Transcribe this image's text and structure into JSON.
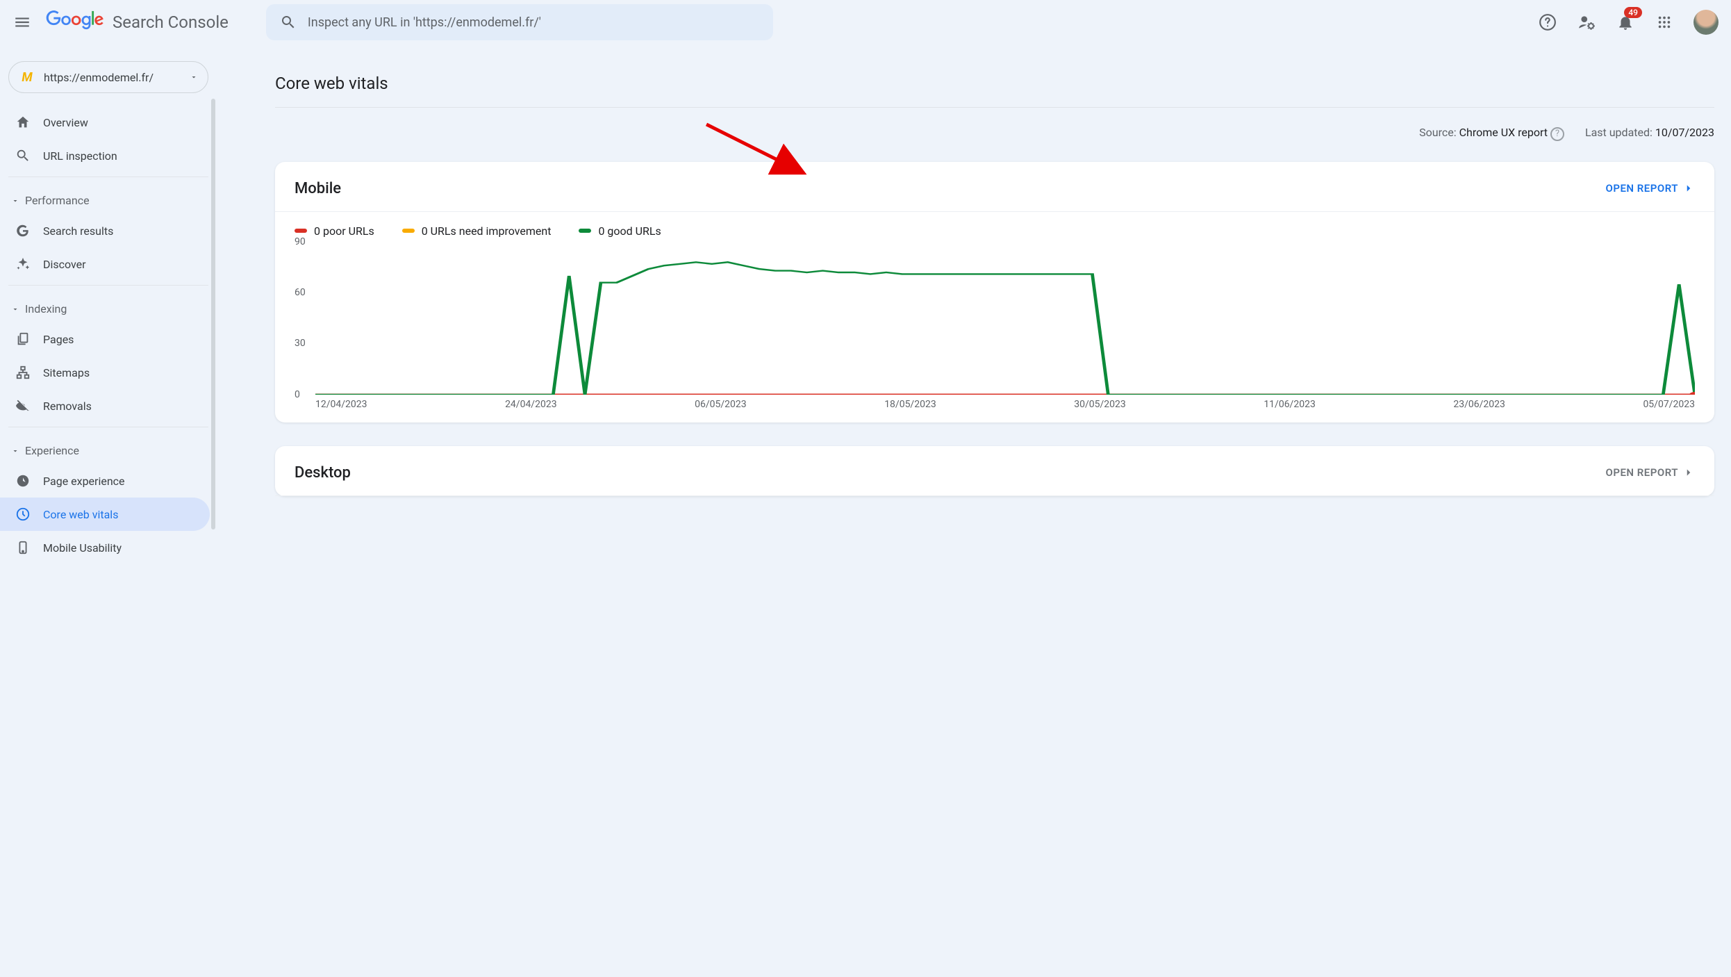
{
  "header": {
    "product": "Search Console",
    "search_placeholder": "Inspect any URL in 'https://enmodemel.fr/'",
    "notif_count": "49"
  },
  "sidebar": {
    "property_url": "https://enmodemel.fr/",
    "overview": "Overview",
    "url_inspection": "URL inspection",
    "sections": {
      "performance": {
        "label": "Performance",
        "items": [
          "Search results",
          "Discover"
        ]
      },
      "indexing": {
        "label": "Indexing",
        "items": [
          "Pages",
          "Sitemaps",
          "Removals"
        ]
      },
      "experience": {
        "label": "Experience",
        "items": [
          "Page experience",
          "Core web vitals",
          "Mobile Usability"
        ]
      }
    },
    "active": "Core web vitals"
  },
  "page": {
    "title": "Core web vitals",
    "source_label": "Source: ",
    "source_value": "Chrome UX report",
    "updated_label": "Last updated: ",
    "updated_value": "10/07/2023"
  },
  "cards": {
    "mobile": {
      "title": "Mobile",
      "open": "OPEN REPORT"
    },
    "desktop": {
      "title": "Desktop",
      "open": "OPEN REPORT"
    }
  },
  "legend": {
    "poor": "0 poor URLs",
    "need": "0 URLs need improvement",
    "good": "0 good URLs"
  },
  "chart_data": {
    "type": "line",
    "x_ticks": [
      "12/04/2023",
      "24/04/2023",
      "06/05/2023",
      "18/05/2023",
      "30/05/2023",
      "11/06/2023",
      "23/06/2023",
      "05/07/2023"
    ],
    "ylim": [
      0,
      90
    ],
    "y_ticks": [
      0,
      30,
      60,
      90
    ],
    "series": [
      {
        "name": "poor",
        "color": "#d93025",
        "values": [
          0,
          0,
          0,
          0,
          0,
          0,
          0,
          0,
          0,
          0,
          0,
          0,
          0,
          0,
          0,
          0,
          0,
          0,
          0,
          0,
          0,
          0,
          0,
          0,
          0,
          0,
          0,
          0,
          0,
          0,
          0,
          0,
          0,
          0,
          0,
          0,
          0,
          0,
          0,
          0,
          0,
          0,
          0,
          0,
          0,
          0,
          0,
          0,
          0,
          0,
          0,
          0,
          0,
          0,
          0,
          0,
          0,
          0,
          0,
          0,
          0,
          0,
          0,
          0,
          0,
          0,
          0,
          0,
          0,
          0,
          0,
          0,
          0,
          0,
          0,
          0,
          0,
          0,
          0,
          0,
          0,
          0,
          0,
          0,
          0,
          0,
          0,
          0
        ]
      },
      {
        "name": "good",
        "color": "#0d8a3a",
        "values": [
          0,
          0,
          0,
          0,
          0,
          0,
          0,
          0,
          0,
          0,
          0,
          0,
          0,
          0,
          0,
          0,
          70,
          0,
          66,
          66,
          70,
          74,
          76,
          77,
          78,
          77,
          78,
          76,
          74,
          73,
          73,
          72,
          73,
          72,
          72,
          71,
          72,
          71,
          71,
          71,
          71,
          71,
          71,
          71,
          71,
          71,
          71,
          71,
          71,
          71,
          0,
          0,
          0,
          0,
          0,
          0,
          0,
          0,
          0,
          0,
          0,
          0,
          0,
          0,
          0,
          0,
          0,
          0,
          0,
          0,
          0,
          0,
          0,
          0,
          0,
          0,
          0,
          0,
          0,
          0,
          0,
          0,
          0,
          0,
          0,
          0,
          65,
          0
        ]
      }
    ]
  }
}
